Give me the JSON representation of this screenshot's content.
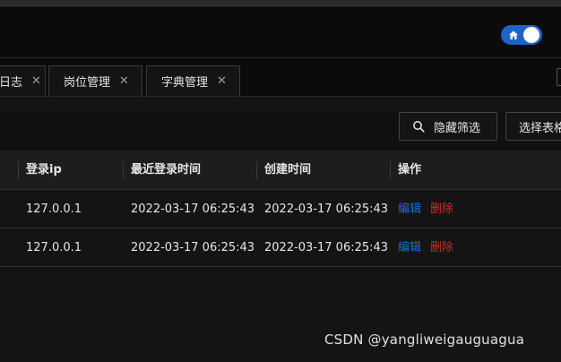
{
  "colors": {
    "accent": "#1f63c7",
    "link_blue": "#1f6fd1",
    "danger_red": "#c4302b",
    "background": "#141414"
  },
  "header": {
    "theme_toggle": {
      "on": true,
      "icon": "house-icon"
    }
  },
  "tabs": [
    {
      "label": "日志",
      "closable": true
    },
    {
      "label": "岗位管理",
      "closable": true
    },
    {
      "label": "字典管理",
      "closable": true
    }
  ],
  "toolbar": {
    "hide_filter": {
      "icon": "search-icon",
      "label": "隐藏筛选"
    },
    "select_columns": {
      "label": "选择表格"
    }
  },
  "table": {
    "columns": [
      "登录ip",
      "最近登录时间",
      "创建时间",
      "操作"
    ],
    "rows": [
      {
        "ip": "127.0.0.1",
        "last_login": "2022-03-17 06:25:43",
        "created": "2022-03-17 06:25:43",
        "edit": "编辑",
        "delete": "删除"
      },
      {
        "ip": "127.0.0.1",
        "last_login": "2022-03-17 06:25:43",
        "created": "2022-03-17 06:25:43",
        "edit": "编辑",
        "delete": "删除"
      }
    ]
  },
  "watermark": "CSDN @yangliweigauguagua"
}
